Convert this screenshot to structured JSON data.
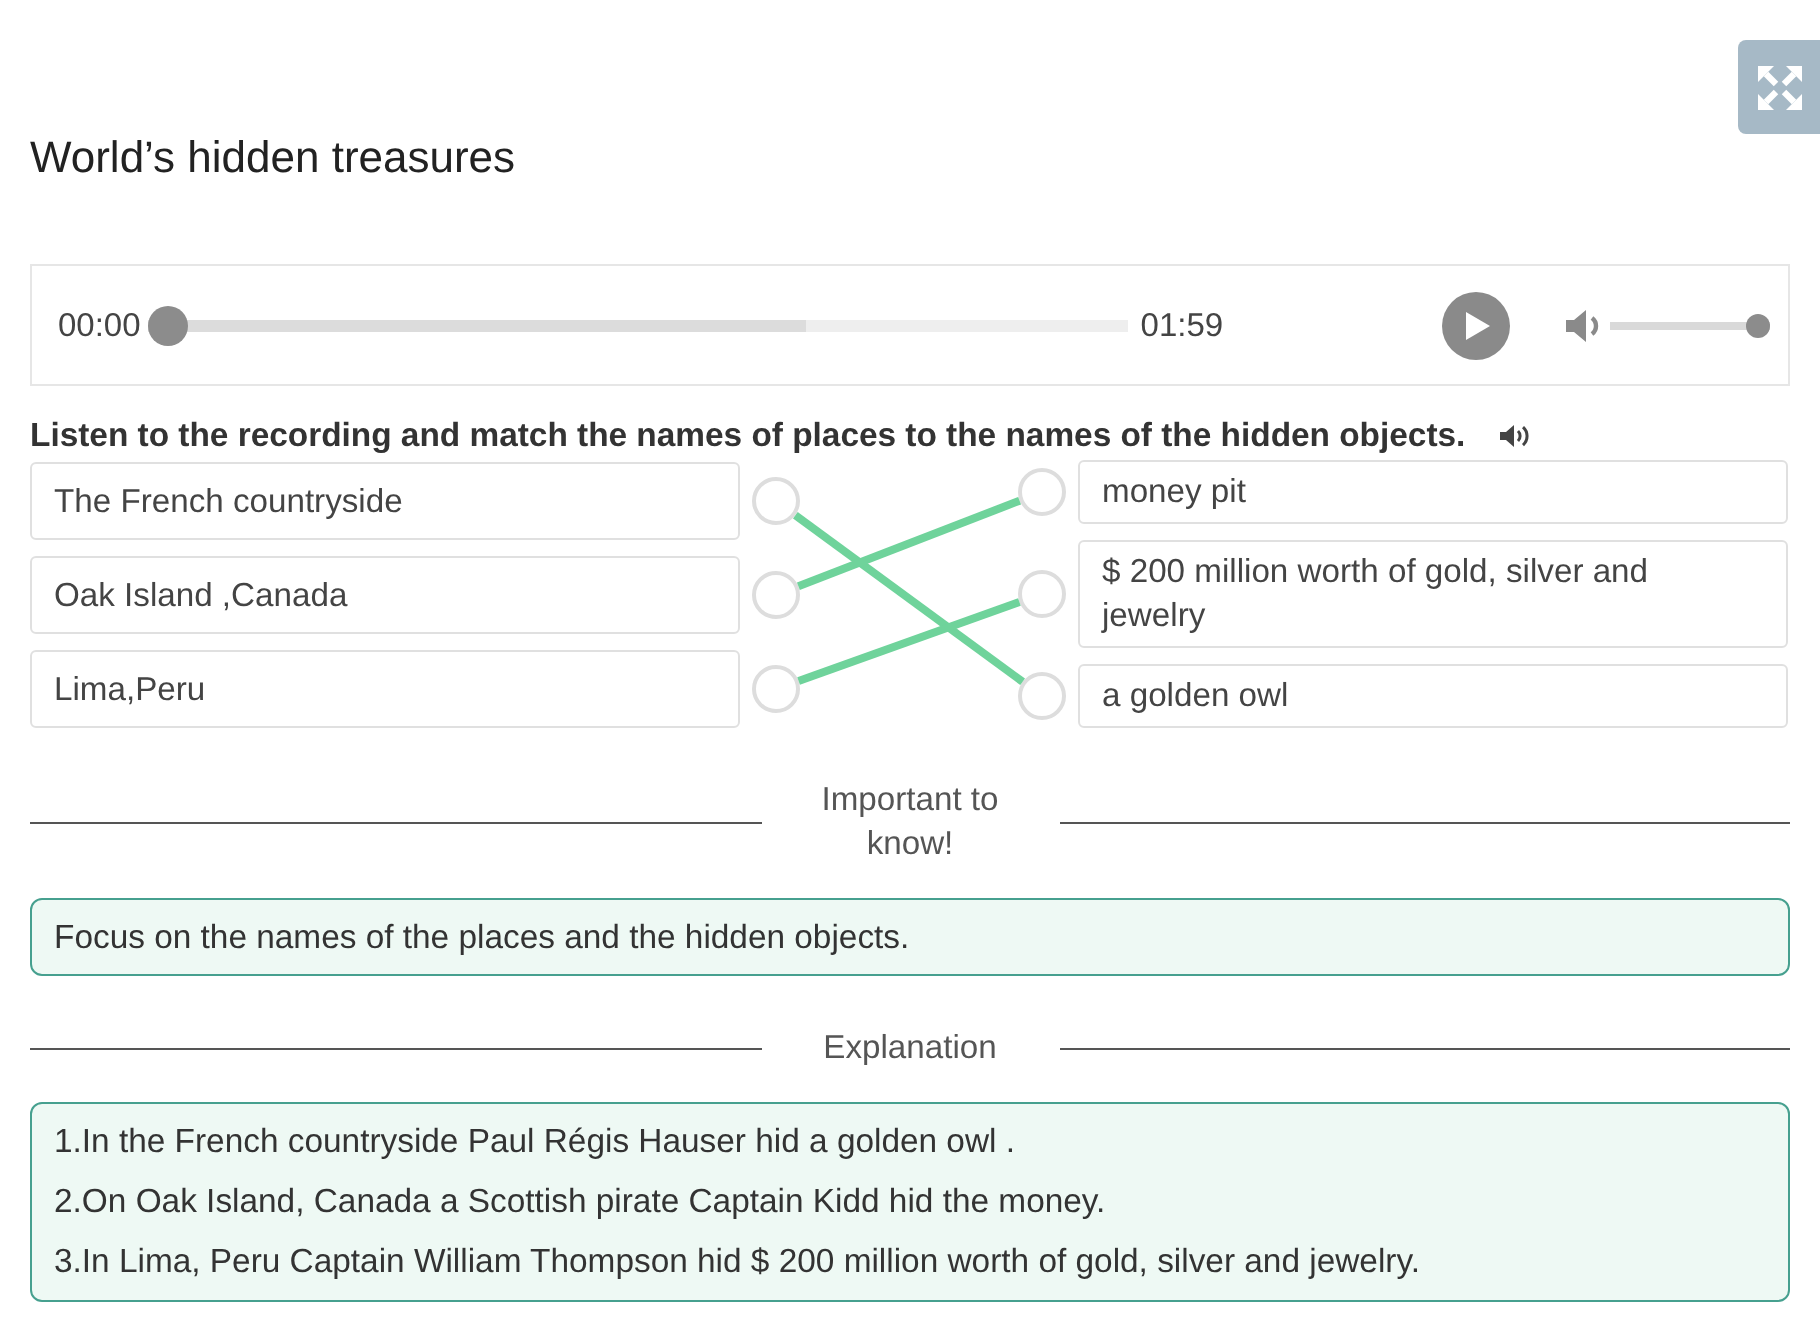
{
  "title": "World’s hidden treasures",
  "player": {
    "elapsed": "00:00",
    "duration": "01:59",
    "seek": {
      "level": 0
    },
    "buffered": {
      "level": 0.67
    },
    "playing": false,
    "volume": {
      "level": 1
    }
  },
  "instruction": "Listen to the recording and match the names of places to the names of the hidden objects.",
  "matching": {
    "places": [
      {
        "label": "The French countryside",
        "links": [
          false,
          false,
          true
        ]
      },
      {
        "label": "Oak Island ,Canada",
        "links": [
          true,
          false,
          false
        ]
      },
      {
        "label": "Lima,Peru",
        "links": [
          false,
          true,
          false
        ]
      }
    ],
    "objects": [
      {
        "label": "money pit"
      },
      {
        "label": "$ 200 million worth of gold, silver and jewelry"
      },
      {
        "label": "a golden owl"
      }
    ]
  },
  "important": {
    "heading": "Important to know!",
    "text": "Focus on the names of the places and the hidden objects."
  },
  "explanation": {
    "heading": "Explanation",
    "lines": [
      "1.In the French countryside Paul Régis Hauser hid a golden owl .",
      "2.On Oak Island, Canada a Scottish pirate Captain Kidd hid the money.",
      "3.In Lima, Peru Captain William Thompson hid $ 200 million worth of gold, silver and jewelry."
    ]
  }
}
